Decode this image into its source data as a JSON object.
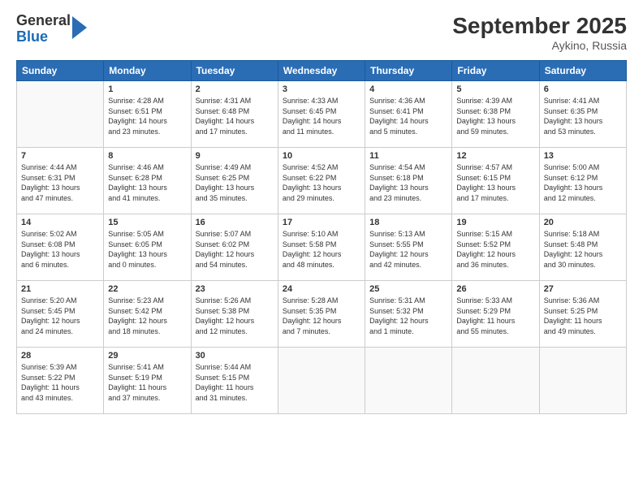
{
  "header": {
    "logo_general": "General",
    "logo_blue": "Blue",
    "title": "September 2025",
    "subtitle": "Aykino, Russia"
  },
  "weekdays": [
    "Sunday",
    "Monday",
    "Tuesday",
    "Wednesday",
    "Thursday",
    "Friday",
    "Saturday"
  ],
  "weeks": [
    [
      {
        "day": "",
        "info": ""
      },
      {
        "day": "1",
        "info": "Sunrise: 4:28 AM\nSunset: 6:51 PM\nDaylight: 14 hours\nand 23 minutes."
      },
      {
        "day": "2",
        "info": "Sunrise: 4:31 AM\nSunset: 6:48 PM\nDaylight: 14 hours\nand 17 minutes."
      },
      {
        "day": "3",
        "info": "Sunrise: 4:33 AM\nSunset: 6:45 PM\nDaylight: 14 hours\nand 11 minutes."
      },
      {
        "day": "4",
        "info": "Sunrise: 4:36 AM\nSunset: 6:41 PM\nDaylight: 14 hours\nand 5 minutes."
      },
      {
        "day": "5",
        "info": "Sunrise: 4:39 AM\nSunset: 6:38 PM\nDaylight: 13 hours\nand 59 minutes."
      },
      {
        "day": "6",
        "info": "Sunrise: 4:41 AM\nSunset: 6:35 PM\nDaylight: 13 hours\nand 53 minutes."
      }
    ],
    [
      {
        "day": "7",
        "info": "Sunrise: 4:44 AM\nSunset: 6:31 PM\nDaylight: 13 hours\nand 47 minutes."
      },
      {
        "day": "8",
        "info": "Sunrise: 4:46 AM\nSunset: 6:28 PM\nDaylight: 13 hours\nand 41 minutes."
      },
      {
        "day": "9",
        "info": "Sunrise: 4:49 AM\nSunset: 6:25 PM\nDaylight: 13 hours\nand 35 minutes."
      },
      {
        "day": "10",
        "info": "Sunrise: 4:52 AM\nSunset: 6:22 PM\nDaylight: 13 hours\nand 29 minutes."
      },
      {
        "day": "11",
        "info": "Sunrise: 4:54 AM\nSunset: 6:18 PM\nDaylight: 13 hours\nand 23 minutes."
      },
      {
        "day": "12",
        "info": "Sunrise: 4:57 AM\nSunset: 6:15 PM\nDaylight: 13 hours\nand 17 minutes."
      },
      {
        "day": "13",
        "info": "Sunrise: 5:00 AM\nSunset: 6:12 PM\nDaylight: 13 hours\nand 12 minutes."
      }
    ],
    [
      {
        "day": "14",
        "info": "Sunrise: 5:02 AM\nSunset: 6:08 PM\nDaylight: 13 hours\nand 6 minutes."
      },
      {
        "day": "15",
        "info": "Sunrise: 5:05 AM\nSunset: 6:05 PM\nDaylight: 13 hours\nand 0 minutes."
      },
      {
        "day": "16",
        "info": "Sunrise: 5:07 AM\nSunset: 6:02 PM\nDaylight: 12 hours\nand 54 minutes."
      },
      {
        "day": "17",
        "info": "Sunrise: 5:10 AM\nSunset: 5:58 PM\nDaylight: 12 hours\nand 48 minutes."
      },
      {
        "day": "18",
        "info": "Sunrise: 5:13 AM\nSunset: 5:55 PM\nDaylight: 12 hours\nand 42 minutes."
      },
      {
        "day": "19",
        "info": "Sunrise: 5:15 AM\nSunset: 5:52 PM\nDaylight: 12 hours\nand 36 minutes."
      },
      {
        "day": "20",
        "info": "Sunrise: 5:18 AM\nSunset: 5:48 PM\nDaylight: 12 hours\nand 30 minutes."
      }
    ],
    [
      {
        "day": "21",
        "info": "Sunrise: 5:20 AM\nSunset: 5:45 PM\nDaylight: 12 hours\nand 24 minutes."
      },
      {
        "day": "22",
        "info": "Sunrise: 5:23 AM\nSunset: 5:42 PM\nDaylight: 12 hours\nand 18 minutes."
      },
      {
        "day": "23",
        "info": "Sunrise: 5:26 AM\nSunset: 5:38 PM\nDaylight: 12 hours\nand 12 minutes."
      },
      {
        "day": "24",
        "info": "Sunrise: 5:28 AM\nSunset: 5:35 PM\nDaylight: 12 hours\nand 7 minutes."
      },
      {
        "day": "25",
        "info": "Sunrise: 5:31 AM\nSunset: 5:32 PM\nDaylight: 12 hours\nand 1 minute."
      },
      {
        "day": "26",
        "info": "Sunrise: 5:33 AM\nSunset: 5:29 PM\nDaylight: 11 hours\nand 55 minutes."
      },
      {
        "day": "27",
        "info": "Sunrise: 5:36 AM\nSunset: 5:25 PM\nDaylight: 11 hours\nand 49 minutes."
      }
    ],
    [
      {
        "day": "28",
        "info": "Sunrise: 5:39 AM\nSunset: 5:22 PM\nDaylight: 11 hours\nand 43 minutes."
      },
      {
        "day": "29",
        "info": "Sunrise: 5:41 AM\nSunset: 5:19 PM\nDaylight: 11 hours\nand 37 minutes."
      },
      {
        "day": "30",
        "info": "Sunrise: 5:44 AM\nSunset: 5:15 PM\nDaylight: 11 hours\nand 31 minutes."
      },
      {
        "day": "",
        "info": ""
      },
      {
        "day": "",
        "info": ""
      },
      {
        "day": "",
        "info": ""
      },
      {
        "day": "",
        "info": ""
      }
    ]
  ]
}
